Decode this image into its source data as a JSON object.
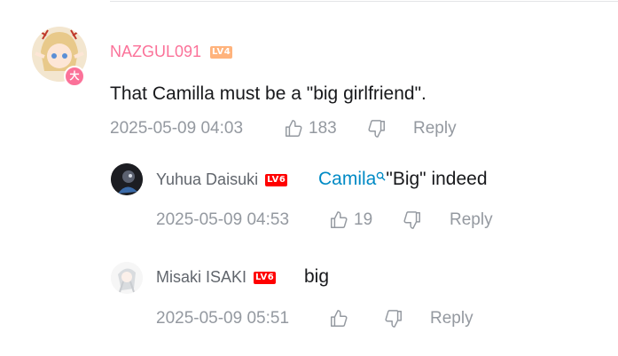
{
  "comment": {
    "username": "NAZGUL091",
    "level": "LV4",
    "text": "That Camilla must be a \"big girlfriend\".",
    "timestamp": "2025-05-09 04:03",
    "likes": "183",
    "reply_label": "Reply",
    "avatar_badge": "大"
  },
  "replies": [
    {
      "username": "Yuhua Daisuki",
      "level": "LV6",
      "mention": "Camila",
      "text": "\"Big\" indeed",
      "timestamp": "2025-05-09 04:53",
      "likes": "19",
      "reply_label": "Reply"
    },
    {
      "username": "Misaki ISAKI",
      "level": "LV6",
      "text": "big",
      "timestamp": "2025-05-09 05:51",
      "reply_label": "Reply"
    }
  ],
  "colors": {
    "username_vip": "#fb7299",
    "username": "#61666d",
    "lv4": "#ffb37c",
    "lv6": "#ff0000",
    "mention": "#008ac5",
    "meta": "#9499a0"
  }
}
